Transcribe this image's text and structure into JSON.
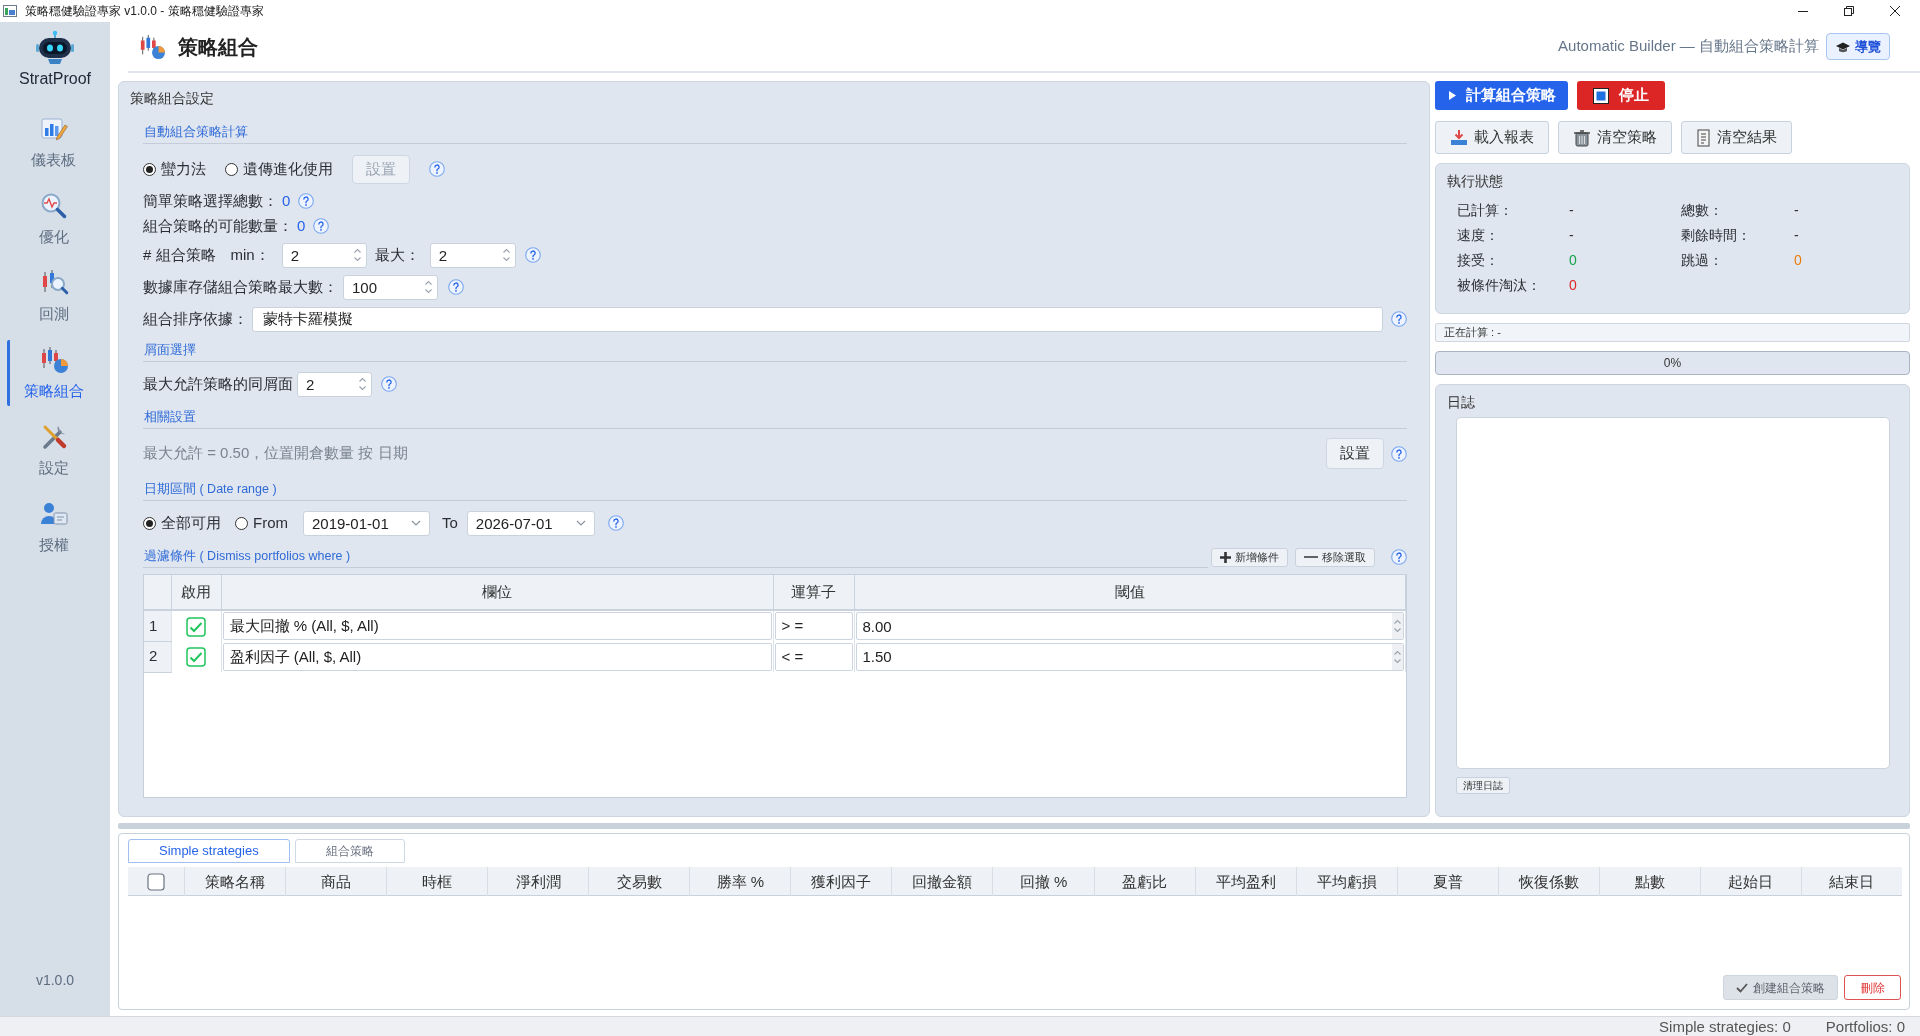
{
  "window": {
    "title": "策略穩健驗證專家 v1.0.0 - 策略穩健驗證專家"
  },
  "sidebar": {
    "app_name": "StratProof",
    "items": [
      {
        "label": "儀表板",
        "selected": false
      },
      {
        "label": "優化",
        "selected": false
      },
      {
        "label": "回測",
        "selected": false
      },
      {
        "label": "策略組合",
        "selected": true
      },
      {
        "label": "設定",
        "selected": false
      },
      {
        "label": "授權",
        "selected": false
      }
    ],
    "version": "v1.0.0"
  },
  "header": {
    "title": "策略組合",
    "subtitle": "Automatic Builder — 自動組合策略計算",
    "guide_button": "導覽"
  },
  "settings_panel": {
    "title": "策略組合設定",
    "auto_calc": {
      "heading": "自動組合策略計算",
      "methods": [
        {
          "label": "蠻力法",
          "selected": true
        },
        {
          "label": "遺傳進化使用",
          "selected": false
        }
      ],
      "setup_button": {
        "label": "設置",
        "disabled": true
      },
      "simple_total": {
        "label": "簡單策略選擇總數：",
        "value": "0"
      },
      "possible_count": {
        "label": "組合策略的可能數量：",
        "value": "0"
      },
      "strategy_count": {
        "label": "# 組合策略",
        "min_label": "min：",
        "min": "2",
        "max_label": "最大：",
        "max": "2"
      },
      "db_max": {
        "label": "數據庫存儲組合策略最大數：",
        "value": "100"
      },
      "sort_by": {
        "label": "組合排序依據：",
        "value": "蒙特卡羅模擬"
      }
    },
    "layer": {
      "heading": "屑面選擇",
      "max_same": {
        "label": "最大允許策略的同屑面",
        "value": "2"
      }
    },
    "correlation": {
      "heading": "相關設置",
      "summary": "最大允許 = 0.50，位置開倉數量 按 日期",
      "setup_button": {
        "label": "設置",
        "disabled": false
      }
    },
    "date_range": {
      "heading": "日期區間 ( Date range )",
      "options": [
        {
          "label": "全部可用",
          "selected": true
        },
        {
          "label": "From",
          "selected": false
        }
      ],
      "from": "2019-01-01",
      "to_label": "To",
      "to": "2026-07-01"
    },
    "filters": {
      "heading": "過濾條件 ( Dismiss portfolios where )",
      "add_button": "新增條件",
      "remove_button": "移除選取",
      "columns": [
        "啟用",
        "欄位",
        "運算子",
        "閾值"
      ],
      "rows": [
        {
          "number": "1",
          "enabled": true,
          "field": "最大回撤 % (All, $, All)",
          "operator": "> =",
          "threshold": "8.00"
        },
        {
          "number": "2",
          "enabled": true,
          "field": "盈利因子 (All, $, All)",
          "operator": "< =",
          "threshold": "1.50"
        }
      ]
    }
  },
  "controls": {
    "run_button": "計算組合策略",
    "stop_button": "停止",
    "load_button": "載入報表",
    "clear_strategies_button": "清空策略",
    "clear_results_button": "清空結果"
  },
  "status_panel": {
    "title": "執行狀態",
    "stats": [
      {
        "label": "已計算：",
        "value": "-",
        "color": "#333333"
      },
      {
        "label": "總數：",
        "value": "-",
        "color": "#333333"
      },
      {
        "label": "速度：",
        "value": "-",
        "color": "#333333"
      },
      {
        "label": "剩餘時間：",
        "value": "-",
        "color": "#333333"
      },
      {
        "label": "接受：",
        "value": "0",
        "color": "#16a34a"
      },
      {
        "label": "跳過：",
        "value": "0",
        "color": "#ea7c0c"
      },
      {
        "label": "被條件淘汰：",
        "value": "0",
        "color": "#dc2626"
      }
    ]
  },
  "current_task": "正在計算 : -",
  "progress": {
    "level": 0,
    "reading": "0%"
  },
  "log_panel": {
    "title": "日誌",
    "clear_button": "清理日誌"
  },
  "results_panel": {
    "tabs": [
      {
        "label": "Simple strategies",
        "selected": true
      },
      {
        "label": "組合策略",
        "selected": false
      }
    ],
    "select_all": {
      "checked": false
    },
    "columns": [
      "策略名稱",
      "商品",
      "時框",
      "淨利潤",
      "交易數",
      "勝率 %",
      "獲利因子",
      "回撤金額",
      "回撤 %",
      "盈虧比",
      "平均盈利",
      "平均虧損",
      "夏普",
      "恢復係數",
      "點數",
      "起始日",
      "結束日"
    ],
    "create_button": {
      "label": "創建組合策略",
      "disabled": true
    },
    "delete_button": "刪除"
  },
  "status_bar": {
    "items": [
      "Simple strategies: 0",
      "Portfolios: 0"
    ]
  }
}
